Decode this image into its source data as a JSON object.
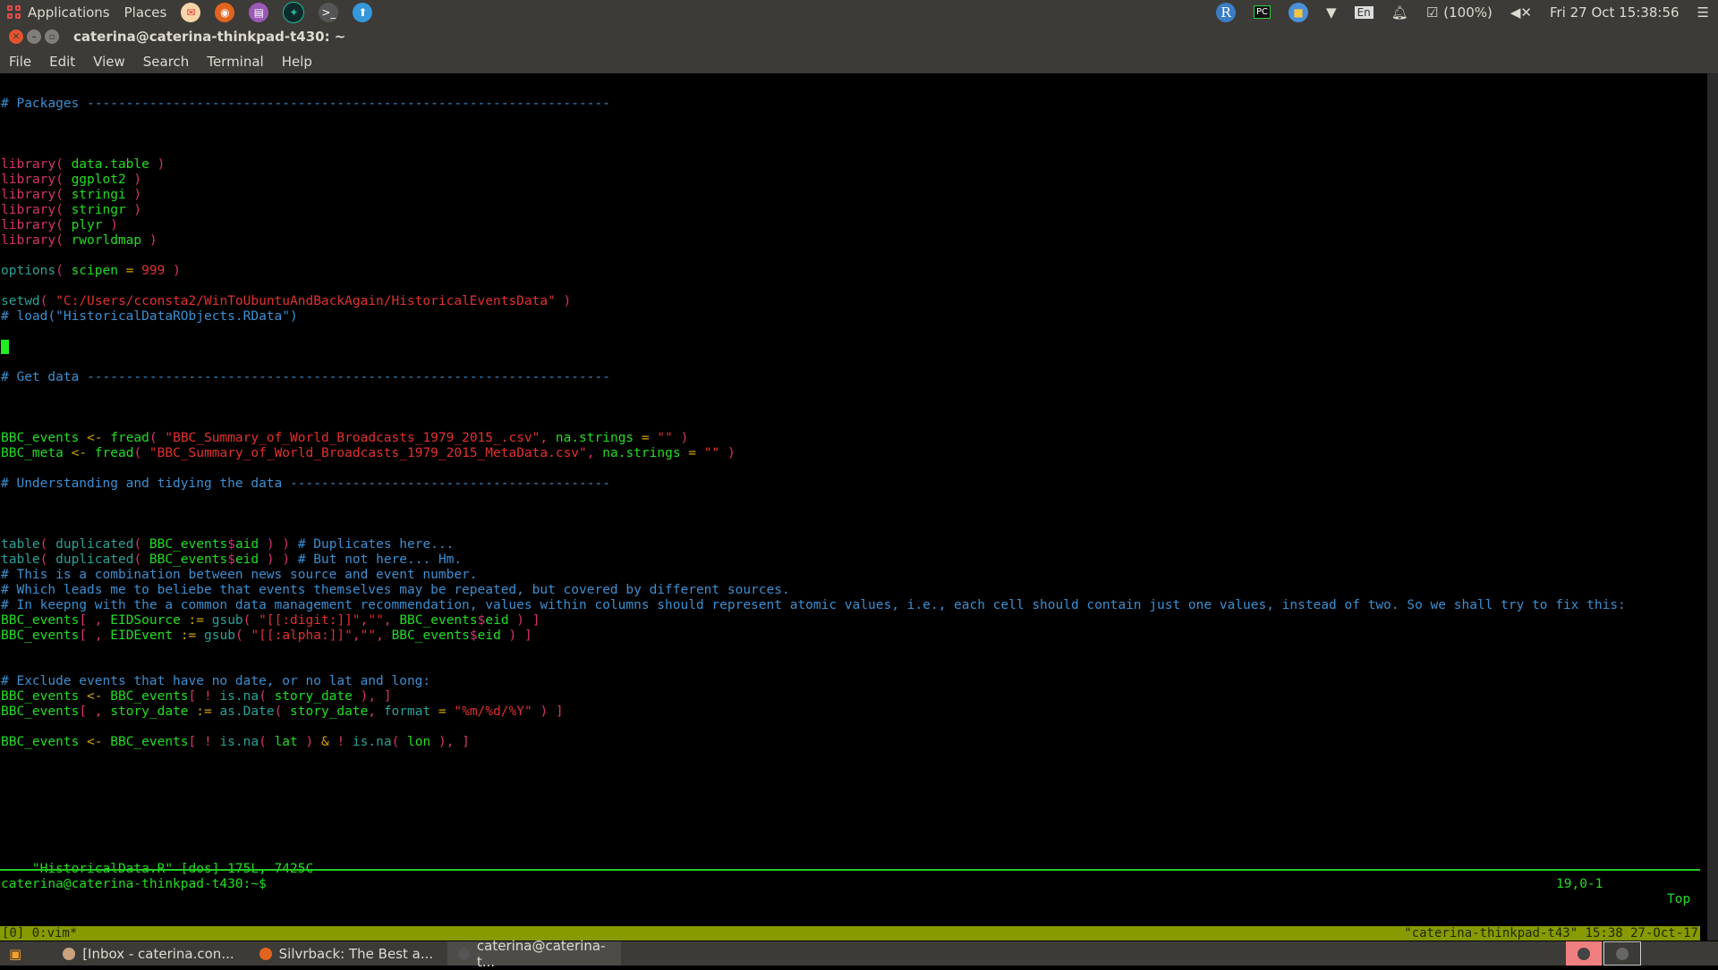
{
  "top_panel": {
    "applications": "Applications",
    "places": "Places",
    "launchers": [
      "mail-icon",
      "firefox-icon",
      "document-viewer-icon",
      "gitkraken-icon",
      "terminal-icon",
      "update-manager-icon"
    ],
    "tray": {
      "battery": "(100%)",
      "clock": "Fri 27 Oct 15:38:56",
      "keyboard": "En"
    }
  },
  "window": {
    "title": "caterina@caterina-thinkpad-t430: ~",
    "menu": [
      "File",
      "Edit",
      "View",
      "Search",
      "Terminal",
      "Help"
    ]
  },
  "editor": {
    "lines": [
      {
        "row": 1,
        "parts": [
          [
            "cmt",
            "# Packages -------------------------------------------------------------------"
          ]
        ]
      },
      {
        "row": 5,
        "parts": [
          [
            "fn",
            "library( "
          ],
          [
            "gr",
            "data.table"
          ],
          [
            "fn",
            " )"
          ]
        ]
      },
      {
        "row": 6,
        "parts": [
          [
            "fn",
            "library( "
          ],
          [
            "gr",
            "ggplot2"
          ],
          [
            "fn",
            " )"
          ]
        ]
      },
      {
        "row": 7,
        "parts": [
          [
            "fn",
            "library( "
          ],
          [
            "gr",
            "stringi"
          ],
          [
            "fn",
            " )"
          ]
        ]
      },
      {
        "row": 8,
        "parts": [
          [
            "fn",
            "library( "
          ],
          [
            "gr",
            "stringr"
          ],
          [
            "fn",
            " )"
          ]
        ]
      },
      {
        "row": 9,
        "parts": [
          [
            "fn",
            "library( "
          ],
          [
            "gr",
            "plyr"
          ],
          [
            "fn",
            " )"
          ]
        ]
      },
      {
        "row": 10,
        "parts": [
          [
            "fn",
            "library( "
          ],
          [
            "gr",
            "rworldmap"
          ],
          [
            "fn",
            " )"
          ]
        ]
      },
      {
        "row": 12,
        "parts": [
          [
            "tl",
            "options"
          ],
          [
            "fn",
            "( "
          ],
          [
            "gr",
            "scipen"
          ],
          [
            "or",
            " = "
          ],
          [
            "rd",
            "999"
          ],
          [
            "fn",
            " )"
          ]
        ]
      },
      {
        "row": 14,
        "parts": [
          [
            "tl",
            "setwd"
          ],
          [
            "fn",
            "( "
          ],
          [
            "rd",
            "\"C:/Users/cconsta2/WinToUbuntuAndBackAgain/HistoricalEventsData\""
          ],
          [
            "fn",
            " )"
          ]
        ]
      },
      {
        "row": 15,
        "parts": [
          [
            "cmt",
            "# load(\"HistoricalDataRObjects.RData\")"
          ]
        ]
      },
      {
        "row": 19,
        "parts": [
          [
            "cmt",
            "# Get data -------------------------------------------------------------------"
          ]
        ]
      },
      {
        "row": 23,
        "parts": [
          [
            "gr",
            "BBC_events "
          ],
          [
            "or",
            "<-"
          ],
          [
            "gr",
            " fread"
          ],
          [
            "fn",
            "( "
          ],
          [
            "rd",
            "\"BBC_Summary_of_World_Broadcasts_1979_2015_.csv\""
          ],
          [
            "fn",
            ", "
          ],
          [
            "gr",
            "na.strings"
          ],
          [
            "or",
            " = "
          ],
          [
            "rd",
            "\"\""
          ],
          [
            "fn",
            " )"
          ]
        ]
      },
      {
        "row": 24,
        "parts": [
          [
            "gr",
            "BBC_meta "
          ],
          [
            "or",
            "<-"
          ],
          [
            "gr",
            " fread"
          ],
          [
            "fn",
            "( "
          ],
          [
            "rd",
            "\"BBC_Summary_of_World_Broadcasts_1979_2015_MetaData.csv\""
          ],
          [
            "fn",
            ", "
          ],
          [
            "gr",
            "na.strings"
          ],
          [
            "or",
            " = "
          ],
          [
            "rd",
            "\"\""
          ],
          [
            "fn",
            " )"
          ]
        ]
      },
      {
        "row": 26,
        "parts": [
          [
            "cmt",
            "# Understanding and tidying the data -----------------------------------------"
          ]
        ]
      },
      {
        "row": 30,
        "parts": [
          [
            "tl",
            "table"
          ],
          [
            "fn",
            "( "
          ],
          [
            "tl",
            "duplicated"
          ],
          [
            "fn",
            "( "
          ],
          [
            "gr",
            "BBC_events"
          ],
          [
            "fn",
            "$"
          ],
          [
            "gr",
            "aid"
          ],
          [
            "fn",
            " ) ) "
          ],
          [
            "cmt",
            "# Duplicates here..."
          ]
        ]
      },
      {
        "row": 31,
        "parts": [
          [
            "tl",
            "table"
          ],
          [
            "fn",
            "( "
          ],
          [
            "tl",
            "duplicated"
          ],
          [
            "fn",
            "( "
          ],
          [
            "gr",
            "BBC_events"
          ],
          [
            "fn",
            "$"
          ],
          [
            "gr",
            "eid"
          ],
          [
            "fn",
            " ) ) "
          ],
          [
            "cmt",
            "# But not here... Hm."
          ]
        ]
      },
      {
        "row": 32,
        "parts": [
          [
            "cmt",
            "# This is a combination between news source and event number."
          ]
        ]
      },
      {
        "row": 33,
        "parts": [
          [
            "cmt",
            "# Which leads me to beliebe that events themselves may be repeated, but covered by different sources."
          ]
        ]
      },
      {
        "row": 34,
        "parts": [
          [
            "cmt",
            "# In keepng with the a common data management recommendation, values within columns should represent atomic values, i.e., each cell should contain just one values, instead of two. So we shall try to fix this:"
          ]
        ]
      },
      {
        "row": 35,
        "parts": [
          [
            "gr",
            "BBC_events"
          ],
          [
            "fn",
            "[ , "
          ],
          [
            "gr",
            "EIDSource "
          ],
          [
            "or",
            ":="
          ],
          [
            "tl",
            " gsub"
          ],
          [
            "fn",
            "( "
          ],
          [
            "rd",
            "\"[[:digit:]]\""
          ],
          [
            "fn",
            ","
          ],
          [
            "rd",
            "\"\""
          ],
          [
            "fn",
            ", "
          ],
          [
            "gr",
            "BBC_events"
          ],
          [
            "fn",
            "$"
          ],
          [
            "gr",
            "eid"
          ],
          [
            "fn",
            " ) ]"
          ]
        ]
      },
      {
        "row": 36,
        "parts": [
          [
            "gr",
            "BBC_events"
          ],
          [
            "fn",
            "[ , "
          ],
          [
            "gr",
            "EIDEvent "
          ],
          [
            "or",
            ":="
          ],
          [
            "tl",
            " gsub"
          ],
          [
            "fn",
            "( "
          ],
          [
            "rd",
            "\"[[:alpha:]]\""
          ],
          [
            "fn",
            ","
          ],
          [
            "rd",
            "\"\""
          ],
          [
            "fn",
            ", "
          ],
          [
            "gr",
            "BBC_events"
          ],
          [
            "fn",
            "$"
          ],
          [
            "gr",
            "eid"
          ],
          [
            "fn",
            " ) ]"
          ]
        ]
      },
      {
        "row": 39,
        "parts": [
          [
            "cmt",
            "# Exclude events that have no date, or no lat and long:"
          ]
        ]
      },
      {
        "row": 40,
        "parts": [
          [
            "gr",
            "BBC_events "
          ],
          [
            "or",
            "<-"
          ],
          [
            "gr",
            " BBC_events"
          ],
          [
            "fn",
            "[ ! "
          ],
          [
            "tl",
            "is.na"
          ],
          [
            "fn",
            "( "
          ],
          [
            "gr",
            "story_date"
          ],
          [
            "fn",
            " ), ]"
          ]
        ]
      },
      {
        "row": 41,
        "parts": [
          [
            "gr",
            "BBC_events"
          ],
          [
            "fn",
            "[ , "
          ],
          [
            "gr",
            "story_date "
          ],
          [
            "or",
            ":="
          ],
          [
            "tl",
            " as.Date"
          ],
          [
            "fn",
            "( "
          ],
          [
            "gr",
            "story_date"
          ],
          [
            "fn",
            ", "
          ],
          [
            "tl",
            "format"
          ],
          [
            "or",
            " = "
          ],
          [
            "rd",
            "\"%m/%d/%Y\""
          ],
          [
            "fn",
            " ) ]"
          ]
        ]
      },
      {
        "row": 43,
        "parts": [
          [
            "gr",
            "BBC_events "
          ],
          [
            "or",
            "<-"
          ],
          [
            "gr",
            " BBC_events"
          ],
          [
            "fn",
            "[ ! "
          ],
          [
            "tl",
            "is.na"
          ],
          [
            "fn",
            "( "
          ],
          [
            "gr",
            "lat"
          ],
          [
            "fn",
            " ) "
          ],
          [
            "or",
            "&"
          ],
          [
            "fn",
            " ! "
          ],
          [
            "tl",
            "is.na"
          ],
          [
            "fn",
            "( "
          ],
          [
            "gr",
            "lon"
          ],
          [
            "fn",
            " ), ]"
          ]
        ]
      }
    ],
    "cursor_row": 17,
    "status_file": "\"HistoricalData.R\" [dos] 175L, 7425C",
    "status_pos": "19,0-1",
    "status_scroll": "Top"
  },
  "shell": {
    "prompt": "caterina@caterina-thinkpad-t430:~$"
  },
  "tmux": {
    "left": "[0] 0:vim*",
    "right": "\"caterina-thinkpad-t43\" 15:38 27-Oct-17"
  },
  "taskbar": {
    "tasks": [
      {
        "label": "[Inbox - caterina.con...",
        "icon": "thunderbird-icon"
      },
      {
        "label": "Silvrback: The Best a...",
        "icon": "firefox-icon"
      },
      {
        "label": "caterina@caterina-t...",
        "icon": "terminal-icon"
      }
    ]
  }
}
